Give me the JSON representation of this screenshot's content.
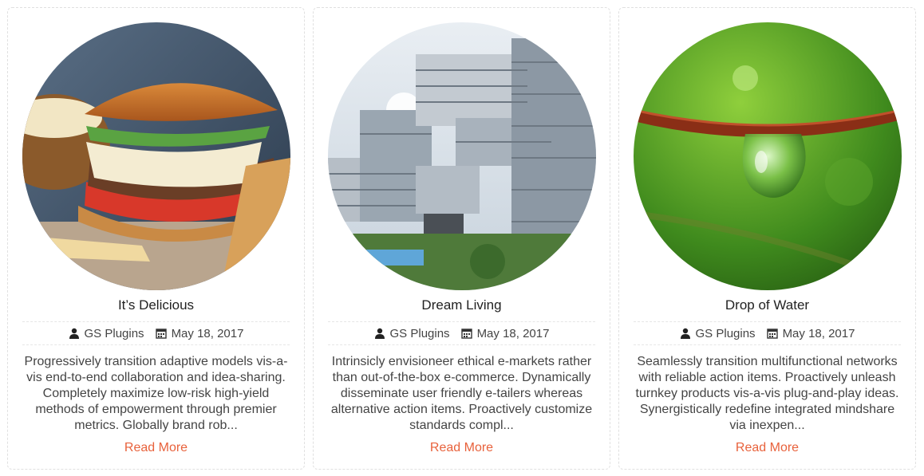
{
  "cards": [
    {
      "title": "It’s Delicious",
      "author": "GS Plugins",
      "date": "May 18, 2017",
      "excerpt": "Progressively transition adaptive models vis-a-vis end-to-end collaboration and idea-sharing. Completely maximize low-risk high-yield methods of empowerment through premier metrics. Globally brand rob...",
      "read_more": "Read More"
    },
    {
      "title": "Dream Living",
      "author": "GS Plugins",
      "date": "May 18, 2017",
      "excerpt": "Intrinsicly envisioneer ethical e-markets rather than out-of-the-box e-commerce. Dynamically disseminate user friendly e-tailers whereas alternative action items. Proactively customize standards compl...",
      "read_more": "Read More"
    },
    {
      "title": "Drop of Water",
      "author": "GS Plugins",
      "date": "May 18, 2017",
      "excerpt": "Seamlessly transition multifunctional networks with reliable action items. Proactively unleash turnkey products vis-a-vis plug-and-play ideas. Synergistically redefine integrated mindshare via inexpen...",
      "read_more": "Read More"
    }
  ],
  "icons": {
    "author": "user-icon",
    "date": "calendar-icon"
  },
  "colors": {
    "accent": "#e8623c",
    "text": "#444444",
    "title": "#222222",
    "border": "#e0e0e0"
  }
}
